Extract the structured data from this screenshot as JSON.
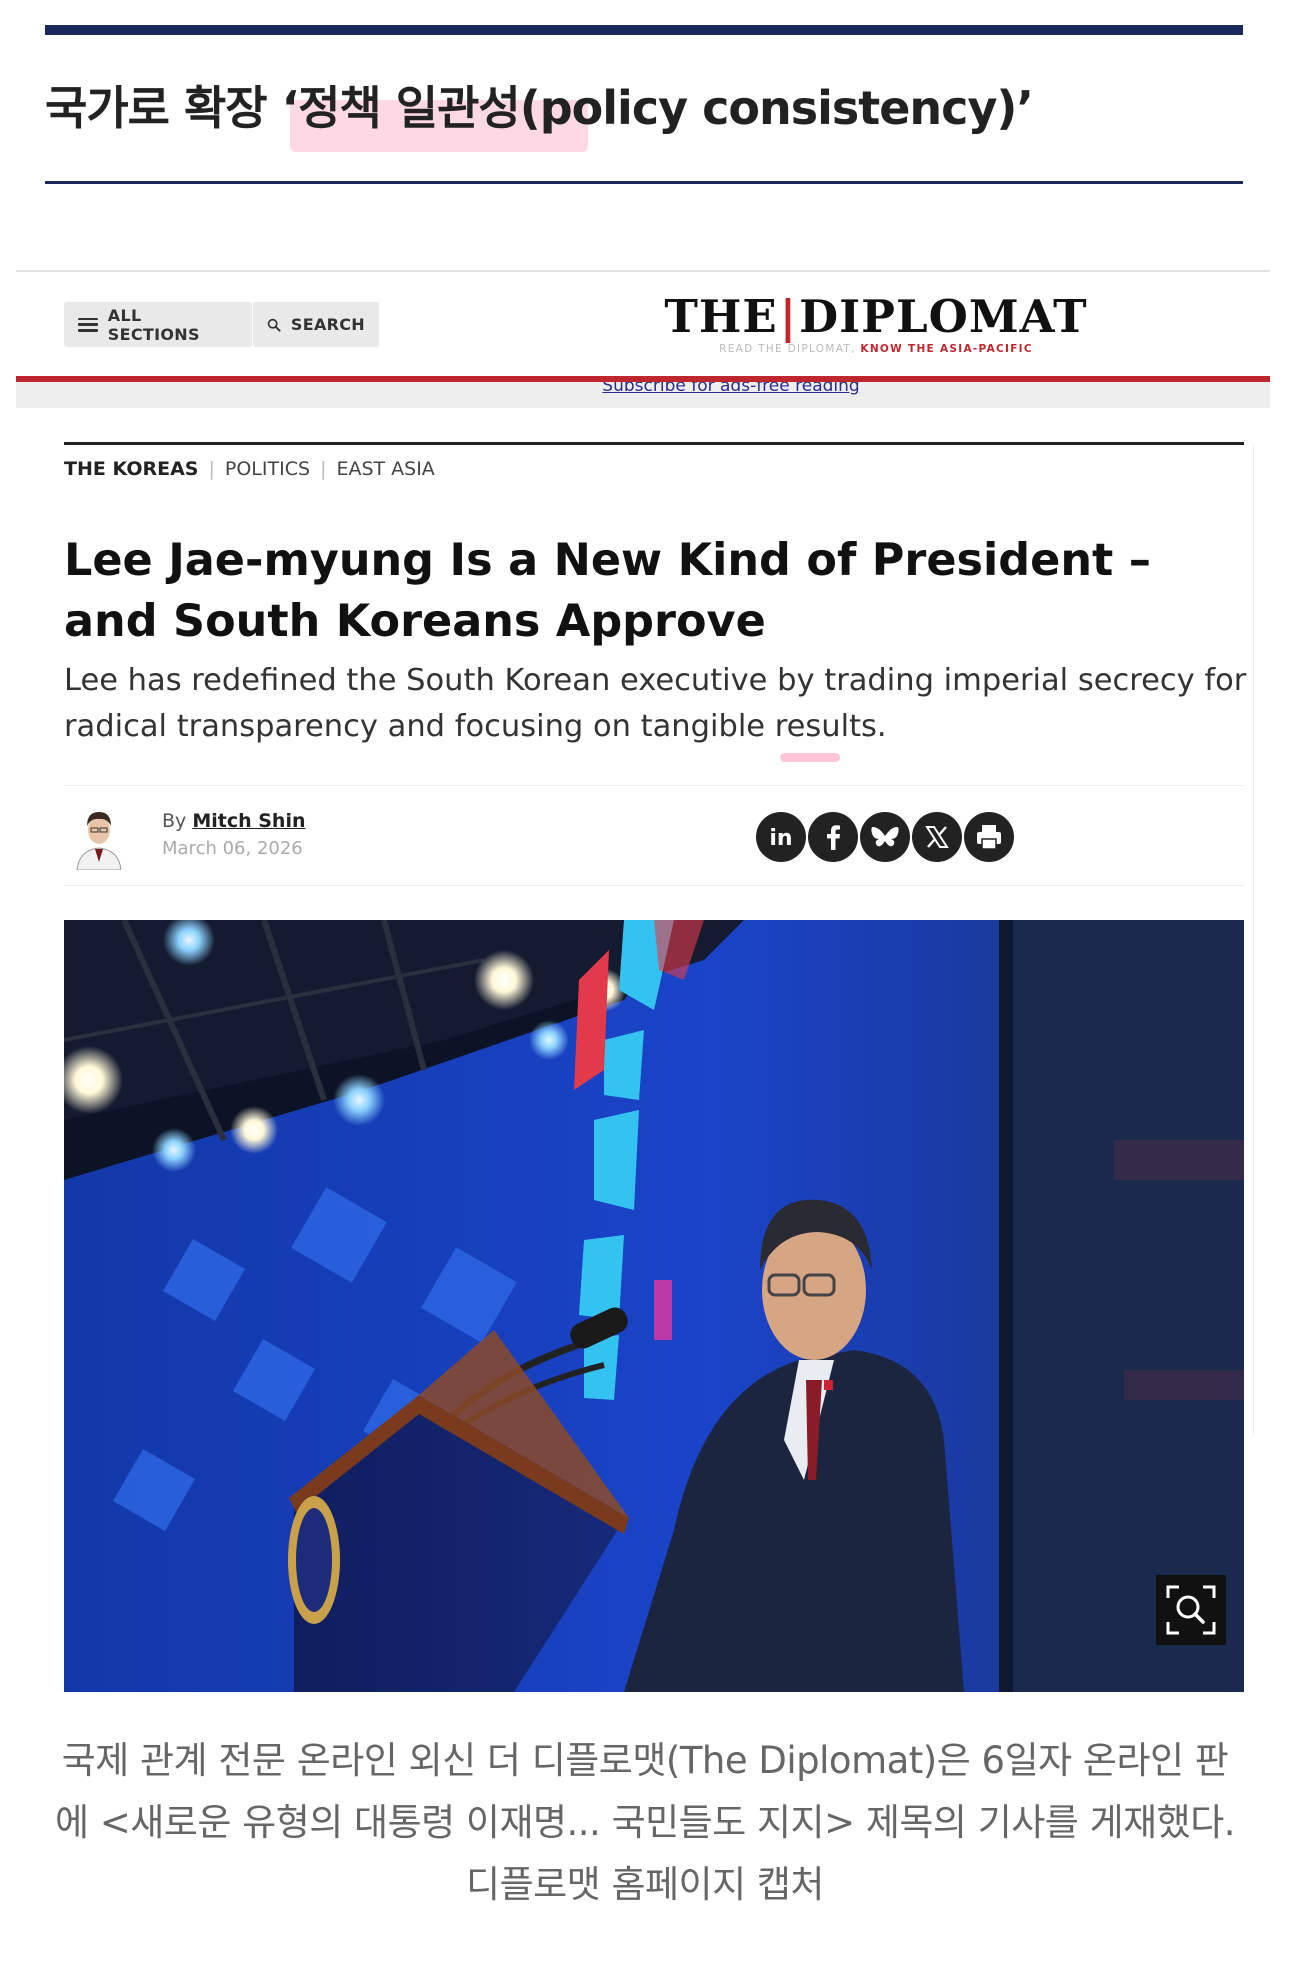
{
  "section": {
    "title_prefix": "국가로 확장 ",
    "title_highlight": "‘정책 일관성",
    "title_suffix": "(policy consistency)’"
  },
  "site": {
    "nav": {
      "all_sections": "ALL SECTIONS",
      "search": "SEARCH"
    },
    "logo": {
      "left": "THE",
      "right": "DIPLOMAT"
    },
    "tagline": {
      "prefix": "READ THE DIPLOMAT, ",
      "emphasis": "KNOW THE ASIA-PACIFIC"
    },
    "subscribe_link": "Subscribe for ads-free reading",
    "accent_color": "#c0262d",
    "link_color": "#2b2b8c"
  },
  "article": {
    "categories": [
      "THE KOREAS",
      "POLITICS",
      "EAST ASIA"
    ],
    "headline": "Lee Jae-myung Is a New Kind of President – and South Koreans Approve",
    "dek": "Lee has redefined the South Korean executive by trading imperial secrecy for radical transparency and focusing on tangible results.",
    "byline": {
      "by": "By ",
      "author": "Mitch Shin",
      "date": "March 06, 2026"
    },
    "share_icons": [
      "linkedin-icon",
      "facebook-icon",
      "bluesky-icon",
      "x-icon",
      "print-icon"
    ],
    "share_labels": {
      "linkedin": "in"
    }
  },
  "caption": "국제 관계 전문 온라인 외신 더 디플로맷(The Diplomat)은 6일자 온라인 판에 <새로운 유형의 대통령 이재명... 국민들도 지지> 제목의 기사를 게재했다. 디플로맷 홈페이지 캡처"
}
